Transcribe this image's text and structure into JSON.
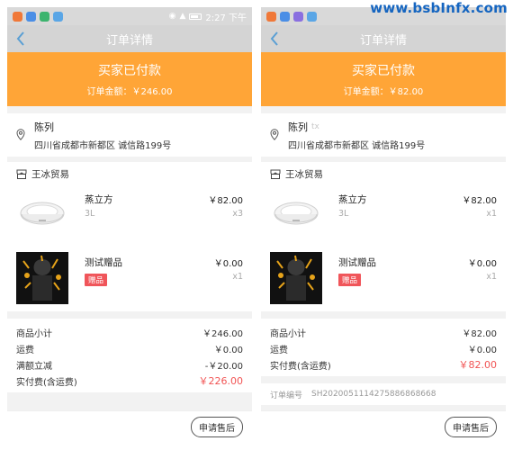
{
  "watermark": "www.bsbInfx.com",
  "colors": {
    "banner": "#ffa537",
    "accent_red": "#f15454",
    "gift_tag": "#f0555a",
    "nav_bg": "#d4d4d4"
  },
  "status_bar": {
    "time": "2:27 下午",
    "app_icons": [
      "#f07838",
      "#4a8ee6",
      "#3cb46e",
      "#5aa6e6"
    ]
  },
  "phones": [
    {
      "nav_title": "订单详情",
      "banner_title": "买家已付款",
      "banner_amount": "订单金额：￥246.00",
      "address": {
        "name": "陈列",
        "phone": "",
        "line": "四川省成都市新都区 诚信路199号"
      },
      "shop_name": "王冰贸易",
      "items": [
        {
          "name": "蒸立方",
          "spec": "3L",
          "price": "￥82.00",
          "qty": "x3",
          "image": "rice-cooker-image"
        },
        {
          "name": "测试赠品",
          "tag": "赠品",
          "price": "￥0.00",
          "qty": "x1",
          "image": "gift-poster-image"
        }
      ],
      "summary": [
        {
          "label": "商品小计",
          "value": "￥246.00"
        },
        {
          "label": "运费",
          "value": "￥0.00"
        },
        {
          "label": "满额立减",
          "value": "-￥20.00"
        },
        {
          "label": "实付费(含运费)",
          "value": "￥226.00",
          "total": true
        }
      ],
      "footer_button": "申请售后"
    },
    {
      "nav_title": "订单详情",
      "banner_title": "买家已付款",
      "banner_amount": "订单金额：￥82.00",
      "address": {
        "name": "陈列",
        "phone": "tx",
        "line": "四川省成都市新都区 诚信路199号"
      },
      "shop_name": "王冰贸易",
      "items": [
        {
          "name": "蒸立方",
          "spec": "3L",
          "price": "￥82.00",
          "qty": "x1",
          "image": "rice-cooker-image"
        },
        {
          "name": "测试赠品",
          "tag": "赠品",
          "price": "￥0.00",
          "qty": "x1",
          "image": "gift-poster-image"
        }
      ],
      "summary": [
        {
          "label": "商品小计",
          "value": "￥82.00"
        },
        {
          "label": "运费",
          "value": "￥0.00"
        },
        {
          "label": "实付费(含运费)",
          "value": "￥82.00",
          "total": true
        }
      ],
      "order_no": {
        "label": "订单编号",
        "value": "SH2020051114275886868668"
      },
      "footer_button": "申请售后"
    }
  ]
}
